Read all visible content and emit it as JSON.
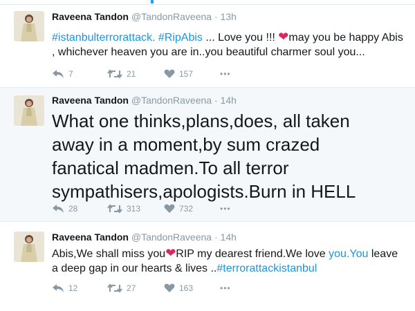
{
  "tweets": [
    {
      "name": "Raveena Tandon",
      "handle": "@TandonRaveena",
      "separator": "·",
      "time": "13h",
      "text": {
        "tag1": "#istanbulterrorattack.",
        "tag2": "#RipAbis",
        "part1": " ... Love you !!! ",
        "heart": "❤",
        "part2": "may you be happy Abis , whichever heaven you are in..you beautiful charmer soul you..."
      },
      "replies": "7",
      "retweets": "21",
      "likes": "157",
      "more": "•••"
    },
    {
      "name": "Raveena Tandon",
      "handle": "@TandonRaveena",
      "separator": "·",
      "time": "14h",
      "text": "What one thinks,plans,does, all taken away in a moment,by sum crazed fanatical madmen.To all terror sympathisers,apologists.Burn in HELL",
      "replies": "28",
      "retweets": "313",
      "likes": "732",
      "more": "•••"
    },
    {
      "name": "Raveena Tandon",
      "handle": "@TandonRaveena",
      "separator": "·",
      "time": "14h",
      "text": {
        "part1": "Abis,We shall miss you",
        "heart": "❤",
        "part2": "RIP my dearest friend.We love ",
        "link": "you.You",
        "part3": " leave a deep gap in our hearts & lives ..",
        "tag": "#terrorattackistanbul"
      },
      "replies": "12",
      "retweets": "27",
      "likes": "163",
      "more": "•••"
    }
  ],
  "colors": {
    "link": "#1b95e0",
    "heart": "#e0245e",
    "muted": "#8899a6",
    "highlight_bg": "#f5f8fa",
    "divider": "#e6ecf0"
  },
  "icons": [
    "reply-icon",
    "retweet-icon",
    "like-icon",
    "more-icon"
  ]
}
